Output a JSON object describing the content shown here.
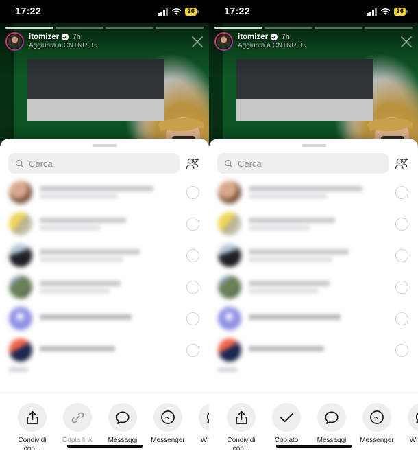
{
  "meta": {
    "app": "Instagram",
    "screen_description": "Instagram story share sheet, two states side by side",
    "locale": "it-IT"
  },
  "status_bar": {
    "time": "17:22",
    "cellular_icon": "signal-bars-icon",
    "wifi_icon": "wifi-icon",
    "battery_level": "26",
    "battery_low_power_color": "#f3d32b"
  },
  "story": {
    "username": "itomizer",
    "verified_badge": true,
    "verified_icon": "verified-check-icon",
    "timestamp": "7h",
    "subtitle": "Aggiunta a CNTNR 3",
    "subtitle_chevron": "›",
    "close_icon": "close-x-icon",
    "avatar_icon": "profile-avatar",
    "progress_segments": 4,
    "progress_completed": 1,
    "ring_color": "#e1306c",
    "background_color": "#0d5524"
  },
  "sheet": {
    "grabber_icon": "drag-handle",
    "search": {
      "placeholder": "Cerca",
      "value": "",
      "search_icon": "search-icon",
      "add_people_icon": "add-people-icon"
    },
    "contacts": [
      {
        "name": "",
        "avatar_colors": [
          "#c99a7e",
          "#8a5f48"
        ],
        "radio_selected": false
      },
      {
        "name": "",
        "avatar_colors": [
          "#e6c84a",
          "#b5ae86"
        ],
        "radio_selected": false
      },
      {
        "name": "",
        "avatar_colors": [
          "#9fb3c8",
          "#23262b"
        ],
        "radio_selected": false
      },
      {
        "name": "",
        "avatar_colors": [
          "#6b7f5a",
          "#3f5240"
        ],
        "radio_selected": false
      },
      {
        "name": "",
        "avatar_colors": [
          "#9b9ce8",
          "#7b7ddd"
        ],
        "radio_selected": false
      },
      {
        "name": "",
        "avatar_colors": [
          "#e8573a",
          "#1f2a55"
        ],
        "radio_selected": false
      }
    ]
  },
  "panels": [
    {
      "id": "before-copy",
      "share_actions": [
        {
          "label": "Condividi con...",
          "icon": "share-upload-icon",
          "state": "default"
        },
        {
          "label": "Copia link",
          "icon": "link-icon",
          "state": "dimmed"
        },
        {
          "label": "Messaggi",
          "icon": "messages-bubble-icon",
          "state": "default"
        },
        {
          "label": "Messenger",
          "icon": "messenger-icon",
          "state": "default"
        },
        {
          "label": "Whats...",
          "icon": "whatsapp-icon",
          "state": "default"
        }
      ]
    },
    {
      "id": "after-copy",
      "share_actions": [
        {
          "label": "Condividi con...",
          "icon": "share-upload-icon",
          "state": "default"
        },
        {
          "label": "Copiato",
          "icon": "checkmark-icon",
          "state": "default"
        },
        {
          "label": "Messaggi",
          "icon": "messages-bubble-icon",
          "state": "default"
        },
        {
          "label": "Messenger",
          "icon": "messenger-icon",
          "state": "default"
        },
        {
          "label": "Whats...",
          "icon": "whatsapp-icon",
          "state": "default"
        }
      ]
    }
  ]
}
